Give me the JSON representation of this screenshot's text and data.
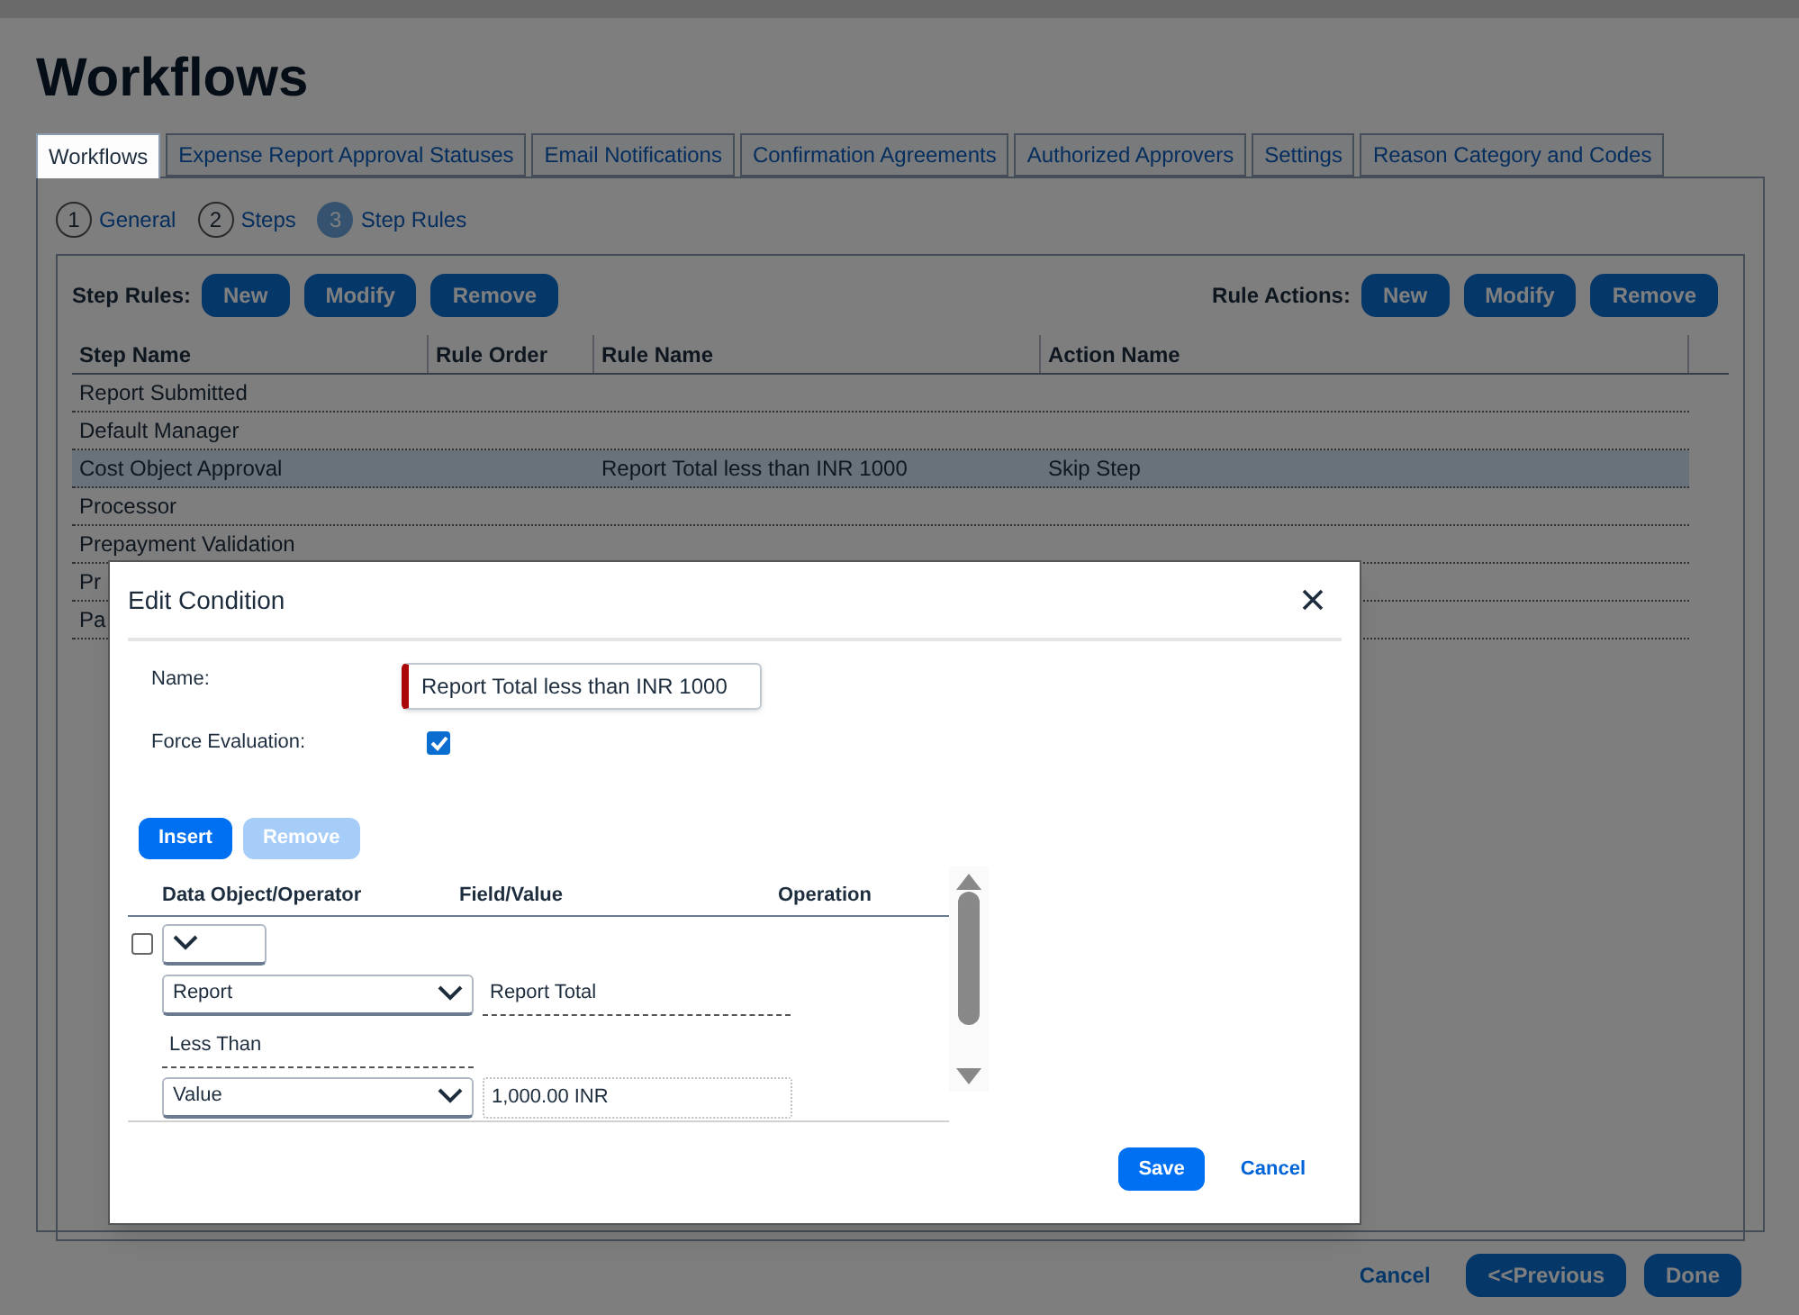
{
  "page_title": "Workflows",
  "tabs": [
    {
      "label": "Workflows",
      "selected": true
    },
    {
      "label": "Expense Report Approval Statuses",
      "selected": false
    },
    {
      "label": "Email Notifications",
      "selected": false
    },
    {
      "label": "Confirmation Agreements",
      "selected": false
    },
    {
      "label": "Authorized Approvers",
      "selected": false
    },
    {
      "label": "Settings",
      "selected": false
    },
    {
      "label": "Reason Category and Codes",
      "selected": false
    }
  ],
  "steps": [
    {
      "number": "1",
      "label": "General",
      "selected": false
    },
    {
      "number": "2",
      "label": "Steps",
      "selected": false
    },
    {
      "number": "3",
      "label": "Step Rules",
      "selected": true
    }
  ],
  "step_rules": {
    "label": "Step Rules:",
    "buttons": [
      "New",
      "Modify",
      "Remove"
    ]
  },
  "rule_actions": {
    "label": "Rule Actions:",
    "buttons": [
      "New",
      "Modify",
      "Remove"
    ]
  },
  "table": {
    "columns": [
      "Step Name",
      "Rule Order",
      "Rule Name",
      "Action Name"
    ],
    "rows": [
      {
        "cells": [
          "Report Submitted",
          "",
          "",
          ""
        ],
        "selected": false
      },
      {
        "cells": [
          "Default Manager",
          "",
          "",
          ""
        ],
        "selected": false
      },
      {
        "cells": [
          "Cost Object Approval",
          "",
          "Report Total less than INR 1000",
          "Skip Step"
        ],
        "selected": true
      },
      {
        "cells": [
          "Processor",
          "",
          "",
          ""
        ],
        "selected": false
      },
      {
        "cells": [
          "Prepayment Validation",
          "",
          "",
          ""
        ],
        "selected": false
      },
      {
        "cells": [
          "Pr",
          "",
          "",
          ""
        ],
        "selected": false
      },
      {
        "cells": [
          "Pa",
          "",
          "",
          ""
        ],
        "selected": false
      }
    ]
  },
  "dialog": {
    "title": "Edit Condition",
    "name_label": "Name:",
    "name_value": "Report Total less than INR 1000",
    "name_required": true,
    "force_label": "Force Evaluation:",
    "force_checked": true,
    "buttons": [
      {
        "label": "Insert",
        "disabled": false
      },
      {
        "label": "Remove",
        "disabled": true
      }
    ],
    "columns": [
      "Data Object/Operator",
      "Field/Value",
      "Operation"
    ],
    "rows": [
      {
        "kind": "new",
        "checked": false
      },
      {
        "kind": "field",
        "object": "Report",
        "field": "Report Total"
      },
      {
        "kind": "operator",
        "operator": "Less Than"
      },
      {
        "kind": "value",
        "object": "Value",
        "value": "1,000.00 INR"
      }
    ],
    "save": "Save",
    "cancel": "Cancel"
  },
  "footer_buttons": [
    {
      "label": "Cancel",
      "kind": "link"
    },
    {
      "label": "<<Previous",
      "kind": "primary"
    },
    {
      "label": "Done",
      "kind": "primary"
    }
  ]
}
